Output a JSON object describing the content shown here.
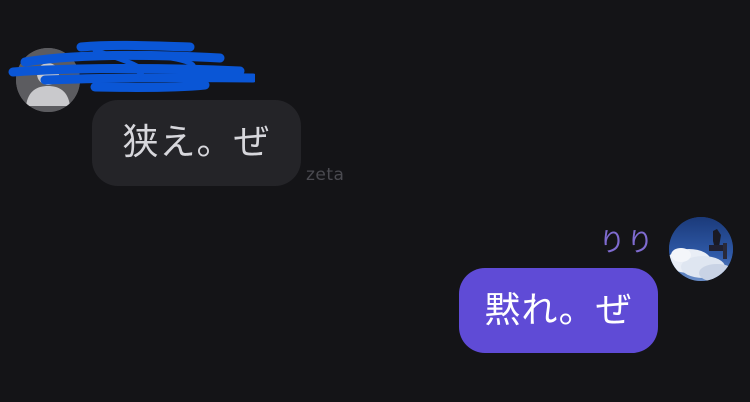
{
  "incoming": {
    "message": "狭え。ぜ",
    "watermark": "zeta"
  },
  "outgoing": {
    "sender_name": "りり",
    "message": "黙れ。ぜ"
  },
  "colors": {
    "background": "#141417",
    "incoming_bubble": "#242428",
    "outgoing_bubble": "#5f4bd6",
    "sender_name": "#7f6bd0",
    "redaction": "#0a56d6"
  },
  "icons": {
    "incoming_avatar": "default-user-avatar-icon",
    "outgoing_avatar": "profile-photo-avatar",
    "redaction": "blue-scribble-redaction"
  }
}
